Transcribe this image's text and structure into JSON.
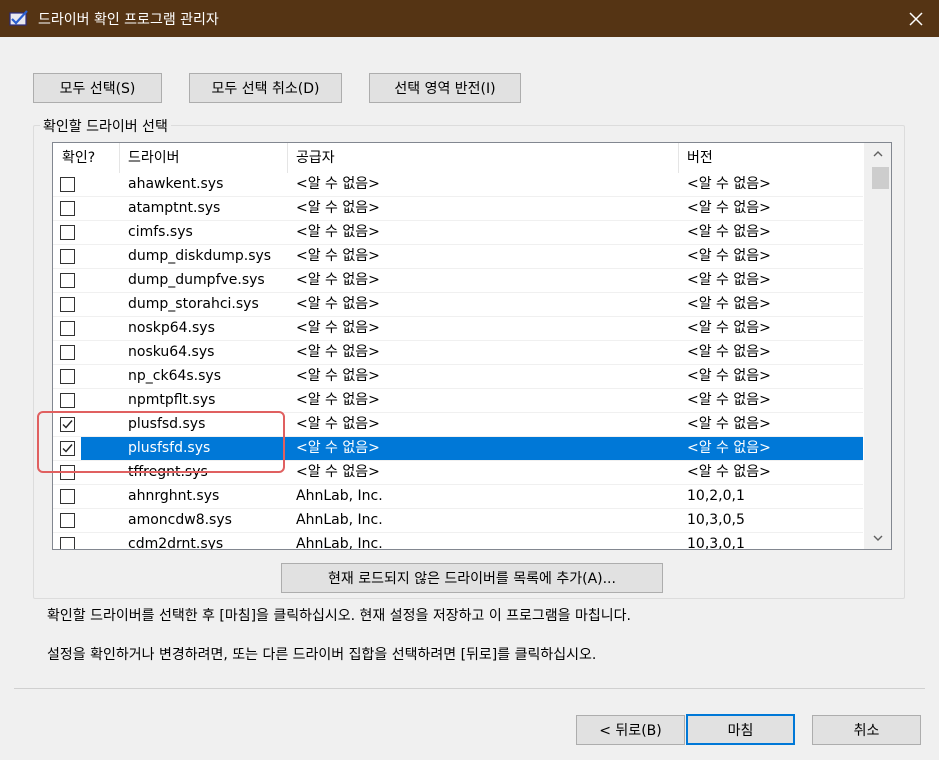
{
  "window": {
    "title": "드라이버 확인 프로그램 관리자",
    "app_icon": "driver-verifier-icon",
    "close_icon": "close-icon"
  },
  "top_buttons": {
    "select_all": "모두 선택(S)",
    "deselect_all": "모두 선택 취소(D)",
    "invert_selection": "선택 영역 반전(I)"
  },
  "group": {
    "label": "확인할 드라이버 선택"
  },
  "table": {
    "columns": [
      "확인?",
      "드라이버",
      "공급자",
      "버전"
    ],
    "rows": [
      {
        "checked": false,
        "driver": "ahawkent.sys",
        "provider": "<알 수 없음>",
        "version": "<알 수 없음>",
        "selected": false
      },
      {
        "checked": false,
        "driver": "atamptnt.sys",
        "provider": "<알 수 없음>",
        "version": "<알 수 없음>",
        "selected": false
      },
      {
        "checked": false,
        "driver": "cimfs.sys",
        "provider": "<알 수 없음>",
        "version": "<알 수 없음>",
        "selected": false
      },
      {
        "checked": false,
        "driver": "dump_diskdump.sys",
        "provider": "<알 수 없음>",
        "version": "<알 수 없음>",
        "selected": false
      },
      {
        "checked": false,
        "driver": "dump_dumpfve.sys",
        "provider": "<알 수 없음>",
        "version": "<알 수 없음>",
        "selected": false
      },
      {
        "checked": false,
        "driver": "dump_storahci.sys",
        "provider": "<알 수 없음>",
        "version": "<알 수 없음>",
        "selected": false
      },
      {
        "checked": false,
        "driver": "noskp64.sys",
        "provider": "<알 수 없음>",
        "version": "<알 수 없음>",
        "selected": false
      },
      {
        "checked": false,
        "driver": "nosku64.sys",
        "provider": "<알 수 없음>",
        "version": "<알 수 없음>",
        "selected": false
      },
      {
        "checked": false,
        "driver": "np_ck64s.sys",
        "provider": "<알 수 없음>",
        "version": "<알 수 없음>",
        "selected": false
      },
      {
        "checked": false,
        "driver": "npmtpflt.sys",
        "provider": "<알 수 없음>",
        "version": "<알 수 없음>",
        "selected": false
      },
      {
        "checked": true,
        "driver": "plusfsd.sys",
        "provider": "<알 수 없음>",
        "version": "<알 수 없음>",
        "selected": false
      },
      {
        "checked": true,
        "driver": "plusfsfd.sys",
        "provider": "<알 수 없음>",
        "version": "<알 수 없음>",
        "selected": true
      },
      {
        "checked": false,
        "driver": "tffregnt.sys",
        "provider": "<알 수 없음>",
        "version": "<알 수 없음>",
        "selected": false
      },
      {
        "checked": false,
        "driver": "ahnrghnt.sys",
        "provider": "AhnLab, Inc.",
        "version": "10,2,0,1",
        "selected": false
      },
      {
        "checked": false,
        "driver": "amoncdw8.sys",
        "provider": "AhnLab, Inc.",
        "version": "10,3,0,5",
        "selected": false
      },
      {
        "checked": false,
        "driver": "cdm2drnt.sys",
        "provider": "AhnLab, Inc.",
        "version": "10,3,0,1",
        "selected": false
      }
    ],
    "checkmark_icon": "checkmark-icon"
  },
  "add_button": "현재 로드되지 않은 드라이버를 목록에 추가(A)...",
  "info": {
    "line1": "확인할 드라이버를 선택한 후 [마침]을 클릭하십시오. 현재 설정을 저장하고 이 프로그램을 마칩니다.",
    "line2": "설정을 확인하거나 변경하려면, 또는 다른 드라이버 집합을 선택하려면 [뒤로]를 클릭하십시오."
  },
  "footer": {
    "back": "< 뒤로(B)",
    "finish": "마침",
    "cancel": "취소"
  },
  "colors": {
    "titlebar": "#553414",
    "selection": "#0078d7",
    "annotation": "#e06060"
  }
}
